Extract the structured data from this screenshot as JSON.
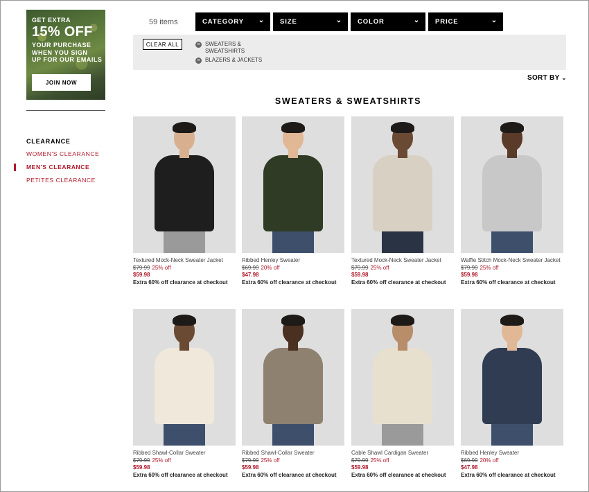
{
  "promo": {
    "line1": "GET EXTRA",
    "headline": "15% OFF",
    "line2": "YOUR PURCHASE",
    "line3": "WHEN YOU SIGN",
    "line4": "UP FOR OUR EMAILS",
    "button": "JOIN NOW"
  },
  "sidebar": {
    "title": "CLEARANCE",
    "items": [
      {
        "label": "WOMEN'S CLEARANCE",
        "active": false
      },
      {
        "label": "MEN'S CLEARANCE",
        "active": true
      },
      {
        "label": "PETITES CLEARANCE",
        "active": false
      }
    ]
  },
  "toolbar": {
    "item_count": "59 items",
    "filters": [
      "CATEGORY",
      "SIZE",
      "COLOR",
      "PRICE"
    ],
    "clear_all": "CLEAR ALL",
    "applied": [
      "SWEATERS & SWEATSHIRTS",
      "BLAZERS & JACKETS"
    ],
    "sort_by": "SORT BY"
  },
  "section_title": "SWEATERS & SWEATSHIRTS",
  "products": [
    {
      "name": "Textured Mock-Neck Sweater Jacket",
      "old_price": "$79.99",
      "discount": "25% off",
      "price": "$59.98",
      "promo": "Extra 60% off clearance at checkout",
      "sweater_color": "#1e1e1e",
      "skin": "#d9b08f",
      "pants": "#9a9a9a"
    },
    {
      "name": "Ribbed Henley Sweater",
      "old_price": "$69.99",
      "discount": "20% off",
      "price": "$47.98",
      "promo": "Extra 60% off clearance at checkout",
      "sweater_color": "#2f3b24",
      "skin": "#e0b896",
      "pants": "#3d4f6b"
    },
    {
      "name": "Textured Mock-Neck Sweater Jacket",
      "old_price": "$79.99",
      "discount": "25% off",
      "price": "$59.98",
      "promo": "Extra 60% off clearance at checkout",
      "sweater_color": "#d8d0c2",
      "skin": "#6b4a34",
      "pants": "#2a3344"
    },
    {
      "name": "Waffle Stitch Mock-Neck Sweater Jacket",
      "old_price": "$79.99",
      "discount": "25% off",
      "price": "$59.98",
      "promo": "Extra 60% off clearance at checkout",
      "sweater_color": "#c8c8c8",
      "skin": "#5a3a28",
      "pants": "#3d4f6b"
    },
    {
      "name": "Ribbed Shawl-Collar Sweater",
      "old_price": "$79.99",
      "discount": "25% off",
      "price": "$59.98",
      "promo": "Extra 60% off clearance at checkout",
      "sweater_color": "#f0e8da",
      "skin": "#6b4a34",
      "pants": "#3d4f6b"
    },
    {
      "name": "Ribbed Shawl-Collar Sweater",
      "old_price": "$79.99",
      "discount": "25% off",
      "price": "$59.98",
      "promo": "Extra 60% off clearance at checkout",
      "sweater_color": "#8f8170",
      "skin": "#4a3020",
      "pants": "#3d4f6b"
    },
    {
      "name": "Cable Shawl Cardigan Sweater",
      "old_price": "$79.99",
      "discount": "25% off",
      "price": "$59.98",
      "promo": "Extra 60% off clearance at checkout",
      "sweater_color": "#e8e0cf",
      "skin": "#b88d6a",
      "pants": "#9a9a9a"
    },
    {
      "name": "Ribbed Henley Sweater",
      "old_price": "$69.99",
      "discount": "20% off",
      "price": "$47.98",
      "promo": "Extra 60% off clearance at checkout",
      "sweater_color": "#2f3c52",
      "skin": "#e0b896",
      "pants": "#3d4f6b"
    }
  ]
}
